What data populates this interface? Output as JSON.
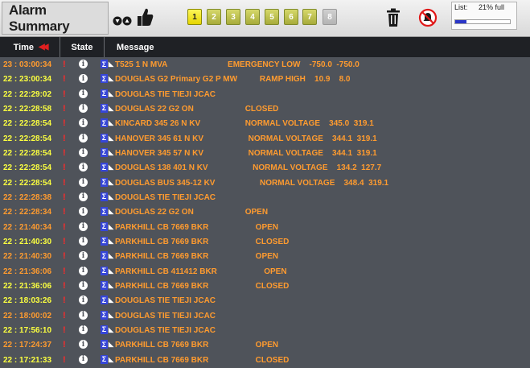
{
  "app": {
    "title": "Alarm Summary"
  },
  "toolbar": {
    "sev_buttons": [
      "1",
      "2",
      "3",
      "4",
      "5",
      "6",
      "7",
      "8"
    ],
    "list_label": "List:",
    "list_value": "21% full",
    "list_fill_fraction": 0.21,
    "colors": {
      "active": "#fdf65a",
      "inactive": "#b7bb45",
      "disabled": "#c8c8c8",
      "list_fill": "#2a36c8"
    }
  },
  "header": {
    "time": "Time",
    "state": "State",
    "message": "Message"
  },
  "alarms": [
    {
      "time": "23 : 03:00:34",
      "message": "T525 1 N MVA                           EMERGENCY LOW    -750.0  -750.0",
      "time_color": "orange"
    },
    {
      "time": "22 : 23:00:34",
      "message": "DOUGLAS G2 Primary G2 P MW          RAMP HIGH    10.9    8.0",
      "time_color": "yellow"
    },
    {
      "time": "22 : 22:29:02",
      "message": "DOUGLAS TIE TIEJI JCAC",
      "time_color": "yellow"
    },
    {
      "time": "22 : 22:28:58",
      "message": "DOUGLAS 22 G2 ON                       CLOSED",
      "time_color": "yellow"
    },
    {
      "time": "22 : 22:28:54",
      "message": "KINCARD 345 26 N KV                    NORMAL VOLTAGE    345.0  319.1",
      "time_color": "yellow"
    },
    {
      "time": "22 : 22:28:54",
      "message": "HANOVER 345 61 N KV                    NORMAL VOLTAGE    344.1  319.1",
      "time_color": "yellow"
    },
    {
      "time": "22 : 22:28:54",
      "message": "HANOVER 345 57 N KV                    NORMAL VOLTAGE    344.1  319.1",
      "time_color": "yellow"
    },
    {
      "time": "22 : 22:28:54",
      "message": "DOUGLAS 138 401 N KV                    NORMAL VOLTAGE    134.2  127.7",
      "time_color": "yellow"
    },
    {
      "time": "22 : 22:28:54",
      "message": "DOUGLAS BUS 345-12 KV                    NORMAL VOLTAGE    348.4  319.1",
      "time_color": "yellow"
    },
    {
      "time": "22 : 22:28:38",
      "message": "DOUGLAS TIE TIEJI JCAC",
      "time_color": "orange"
    },
    {
      "time": "22 : 22:28:34",
      "message": "DOUGLAS 22 G2 ON                       OPEN",
      "time_color": "orange"
    },
    {
      "time": "22 : 21:40:34",
      "message": "PARKHILL CB 7669 BKR                     OPEN",
      "time_color": "orange"
    },
    {
      "time": "22 : 21:40:30",
      "message": "PARKHILL CB 7669 BKR                     CLOSED",
      "time_color": "yellow"
    },
    {
      "time": "22 : 21:40:30",
      "message": "PARKHILL CB 7669 BKR                     OPEN",
      "time_color": "orange"
    },
    {
      "time": "22 : 21:36:06",
      "message": "PARKHILL CB 411412 BKR                     OPEN",
      "time_color": "orange"
    },
    {
      "time": "22 : 21:36:06",
      "message": "PARKHILL CB 7669 BKR                     CLOSED",
      "time_color": "yellow"
    },
    {
      "time": "22 : 18:03:26",
      "message": "DOUGLAS TIE TIEJI JCAC",
      "time_color": "yellow"
    },
    {
      "time": "22 : 18:00:02",
      "message": "DOUGLAS TIE TIEJI JCAC",
      "time_color": "orange"
    },
    {
      "time": "22 : 17:56:10",
      "message": "DOUGLAS TIE TIEJI JCAC",
      "time_color": "yellow"
    },
    {
      "time": "22 : 17:24:37",
      "message": "PARKHILL CB 7669 BKR                     OPEN",
      "time_color": "orange"
    },
    {
      "time": "22 : 17:21:33",
      "message": "PARKHILL CB 7669 BKR                     CLOSED",
      "time_color": "yellow"
    }
  ]
}
